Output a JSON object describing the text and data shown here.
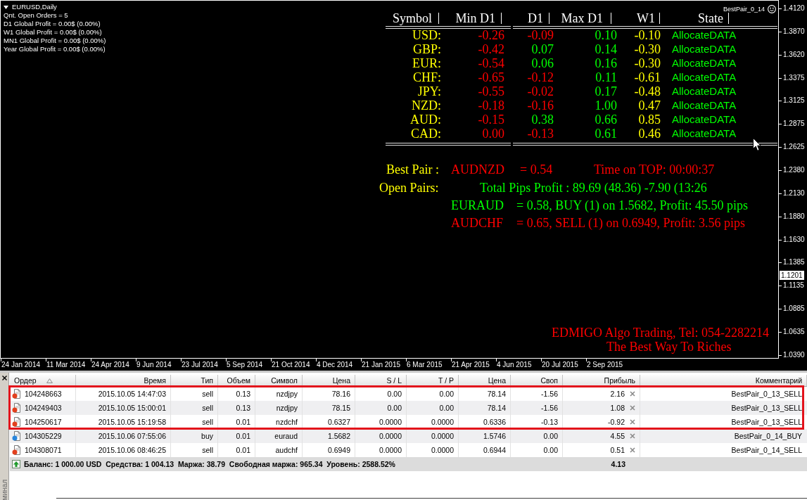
{
  "chart": {
    "title": "EURUSD,Daily",
    "info_lines": [
      "Qnt. Open Orders = 5",
      "D1 Global Profit = 0.00$ (0.00%)",
      "W1 Global Profit = 0.00$ (0.00%)",
      "MN1 Global Profit = 0.00$ (0.00%)",
      "Year Global Profit = 0.00$ (0.00%)"
    ],
    "expert_name": "BestPair_0_14",
    "currency_table": {
      "columns": [
        "Symbol",
        "Min D1",
        "D1",
        "Max D1",
        "W1",
        "State"
      ],
      "rows": [
        {
          "symbol": "USD:",
          "min_d1": "-0.26",
          "d1": {
            "value": "-0.09",
            "color": "#ff0000"
          },
          "max_d1": "0.10",
          "w1": "-0.10",
          "state": "AllocateDATA"
        },
        {
          "symbol": "GBP:",
          "min_d1": "-0.42",
          "d1": {
            "value": "0.07",
            "color": "#00ff00"
          },
          "max_d1": "0.14",
          "w1": "-0.30",
          "state": "AllocateDATA"
        },
        {
          "symbol": "EUR:",
          "min_d1": "-0.54",
          "d1": {
            "value": "0.06",
            "color": "#00ff00"
          },
          "max_d1": "0.16",
          "w1": "-0.30",
          "state": "AllocateDATA"
        },
        {
          "symbol": "CHF:",
          "min_d1": "-0.65",
          "d1": {
            "value": "-0.12",
            "color": "#ff0000"
          },
          "max_d1": "0.11",
          "w1": "-0.61",
          "state": "AllocateDATA"
        },
        {
          "symbol": "JPY:",
          "min_d1": "-0.55",
          "d1": {
            "value": "-0.02",
            "color": "#ff0000"
          },
          "max_d1": "0.17",
          "w1": "-0.48",
          "state": "AllocateDATA"
        },
        {
          "symbol": "NZD:",
          "min_d1": "-0.18",
          "d1": {
            "value": "-0.16",
            "color": "#ff0000"
          },
          "max_d1": "1.00",
          "w1": "0.47",
          "state": "AllocateDATA"
        },
        {
          "symbol": "AUD:",
          "min_d1": "-0.15",
          "d1": {
            "value": "0.38",
            "color": "#00ff00"
          },
          "max_d1": "0.66",
          "w1": "0.85",
          "state": "AllocateDATA"
        },
        {
          "symbol": "CAD:",
          "min_d1": "0.00",
          "d1": {
            "value": "-0.13",
            "color": "#ff0000"
          },
          "max_d1": "0.61",
          "w1": "0.46",
          "state": "AllocateDATA"
        }
      ]
    },
    "best_pair": {
      "label": "Best Pair :",
      "pair": "AUDNZD",
      "value": "= 0.54",
      "time_on_top": "Time on TOP: 00:00:37"
    },
    "open_pairs": {
      "label": "Open Pairs:",
      "total": "Total Pips Profit : 89.69 (48.36) -7.90 (13:26",
      "positions": [
        {
          "pair": "EURAUD",
          "details": "= 0.58, BUY (1) on 1.5682, Profit: 45.50 pips",
          "color": "#00ff00"
        },
        {
          "pair": "AUDCHF",
          "details": "= 0.65, SELL (1) on 0.6949, Profit: 3.56 pips",
          "color": "#ff0000"
        }
      ]
    },
    "footer": [
      "EDMIGO Algo Trading, Tel: 054-2282214",
      "The Best Way To Riches"
    ],
    "price_axis": [
      "1.4120",
      "1.3870",
      "1.3620",
      "1.3375",
      "1.3125",
      "1.2875",
      "1.2625",
      "1.2380",
      "1.2130",
      "1.1880",
      "1.1630",
      "1.1385",
      "1.1135",
      "1.0885",
      "1.0635",
      "1.0390"
    ],
    "current_price": "1.1201",
    "time_axis": [
      "24 Jan 2014",
      "11 Mar 2014",
      "24 Apr 2014",
      "9 Jun 2014",
      "23 Jul 2014",
      "5 Sep 2014",
      "21 Oct 2014",
      "4 Dec 2014",
      "21 Jan 2015",
      "6 Mar 2015",
      "21 Apr 2015",
      "4 Jun 2015",
      "20 Jul 2015",
      "2 Sep 2015"
    ]
  },
  "terminal": {
    "side_label": "минал",
    "columns": [
      {
        "label": "Ордер",
        "sorted": true
      },
      {
        "label": "Время",
        "sorted": false
      },
      {
        "label": "Тип",
        "sorted": false
      },
      {
        "label": "Объем",
        "sorted": false
      },
      {
        "label": "Символ",
        "sorted": false
      },
      {
        "label": "Цена",
        "sorted": false
      },
      {
        "label": "S / L",
        "sorted": false
      },
      {
        "label": "T / P",
        "sorted": false
      },
      {
        "label": "Цена",
        "sorted": false
      },
      {
        "label": "Своп",
        "sorted": false
      },
      {
        "label": "Прибыль",
        "sorted": false
      },
      {
        "label": "Комментарий",
        "sorted": false
      }
    ],
    "rows": [
      {
        "order": "104248663",
        "time": "2015.10.05 14:47:03",
        "type": "sell",
        "volume": "0.13",
        "symbol": "nzdjpy",
        "open_price": "78.16",
        "sl": "0.00",
        "tp": "0.00",
        "price": "78.14",
        "swap": "-1.56",
        "profit": "2.16",
        "comment": "BestPair_0_13_SELL",
        "color": "#e2401e",
        "highlighted": true
      },
      {
        "order": "104249403",
        "time": "2015.10.05 15:00:01",
        "type": "sell",
        "volume": "0.13",
        "symbol": "nzdjpy",
        "open_price": "78.15",
        "sl": "0.00",
        "tp": "0.00",
        "price": "78.14",
        "swap": "-1.56",
        "profit": "1.08",
        "comment": "BestPair_0_13_SELL",
        "color": "#e2401e",
        "highlighted": true
      },
      {
        "order": "104250617",
        "time": "2015.10.05 15:19:58",
        "type": "sell",
        "volume": "0.01",
        "symbol": "nzdchf",
        "open_price": "0.6327",
        "sl": "0.0000",
        "tp": "0.0000",
        "price": "0.6336",
        "swap": "-0.13",
        "profit": "-0.92",
        "comment": "BestPair_0_13_SELL",
        "color": "#e2401e",
        "highlighted": true
      },
      {
        "order": "104305229",
        "time": "2015.10.06 07:55:06",
        "type": "buy",
        "volume": "0.01",
        "symbol": "euraud",
        "open_price": "1.5682",
        "sl": "0.0000",
        "tp": "0.0000",
        "price": "1.5746",
        "swap": "0.00",
        "profit": "4.55",
        "comment": "BestPair_0_14_BUY",
        "color": "#2a86dc",
        "highlighted": false
      },
      {
        "order": "104308071",
        "time": "2015.10.06 08:46:25",
        "type": "sell",
        "volume": "0.01",
        "symbol": "audchf",
        "open_price": "0.6949",
        "sl": "0.0000",
        "tp": "0.0000",
        "price": "0.6944",
        "swap": "0.00",
        "profit": "0.51",
        "comment": "BestPair_0_14_SELL",
        "color": "#e2401e",
        "highlighted": false
      }
    ],
    "summary": {
      "text": "Баланс: 1 000.00 USD  Средства: 1 004.13  Маржа: 38.79  Свободная маржа: 965.34  Уровень: 2588.52%",
      "profit": "4.13"
    }
  }
}
